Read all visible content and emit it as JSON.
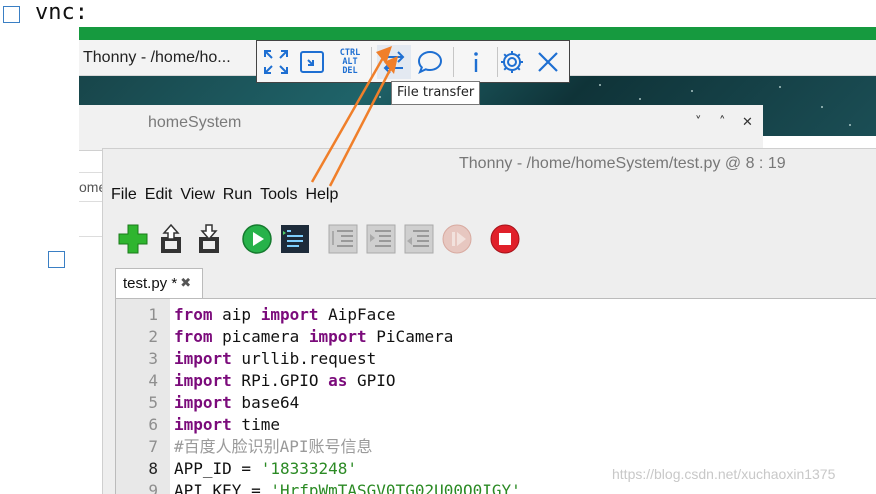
{
  "page": {
    "heading": "vnc:",
    "left_stub_text": "ome",
    "watermark": "https://blog.csdn.net/xuchaoxin1375"
  },
  "vnc_window": {
    "title": "Thonny  -  /home/ho...",
    "toolbar": {
      "buttons": [
        {
          "name": "full-screen",
          "icon": "expand-arrows-icon"
        },
        {
          "name": "scale",
          "icon": "scale-to-window-icon"
        },
        {
          "name": "ctrl-alt-del",
          "label": "CTRL\nALT\nDEL"
        },
        {
          "name": "file-transfer",
          "icon": "file-transfer-icon"
        },
        {
          "name": "chat",
          "icon": "chat-bubble-icon"
        },
        {
          "name": "info",
          "icon": "info-icon"
        },
        {
          "name": "options",
          "icon": "gear-icon"
        },
        {
          "name": "close",
          "icon": "close-icon"
        }
      ],
      "ctrl_label_1": "CTRL",
      "ctrl_label_2": "ALT",
      "ctrl_label_3": "DEL",
      "tooltip": "File transfer"
    },
    "accent_color": "#169a3f",
    "icon_color": "#1e6fd2",
    "annotation_arrow_color": "#f07f2a"
  },
  "home_window": {
    "title": "homeSystem",
    "controls": [
      "˅",
      "˄",
      "✕"
    ]
  },
  "thonny": {
    "title": "Thonny  -  /home/homeSystem/test.py  @  8 : 19",
    "menu": [
      "File",
      "Edit",
      "View",
      "Run",
      "Tools",
      "Help"
    ],
    "toolbar_icons": [
      "new-file-icon",
      "load-icon",
      "save-icon",
      "run-icon",
      "debug-icon",
      "step-over-icon",
      "step-into-icon",
      "step-out-icon",
      "resume-icon",
      "stop-icon"
    ],
    "tab": {
      "label": "test.py *",
      "close": "✖"
    },
    "line_numbers": [
      "1",
      "2",
      "3",
      "4",
      "5",
      "6",
      "7",
      "8",
      "9"
    ],
    "current_line": "8",
    "code": {
      "l1": {
        "kw1": "from",
        "t1": " aip ",
        "kw2": "import",
        "t2": " AipFace"
      },
      "l2": {
        "kw1": "from",
        "t1": " picamera ",
        "kw2": "import",
        "t2": " PiCamera"
      },
      "l3": {
        "kw1": "import",
        "t1": " urllib.request"
      },
      "l4": {
        "kw1": "import",
        "t1": " RPi.GPIO ",
        "kw2": "as",
        "t2": " GPIO"
      },
      "l5": {
        "kw1": "import",
        "t1": " base64"
      },
      "l6": {
        "kw1": "import",
        "t1": " time"
      },
      "l7": {
        "comment": "#百度人脸识别API账号信息"
      },
      "l8": {
        "t1": "APP_ID = ",
        "str": "'18333248'"
      },
      "l9": {
        "t1": "API_KEY = ",
        "str": "'HrfpWmTASGV0TG02U00Q0IGY'"
      }
    }
  }
}
